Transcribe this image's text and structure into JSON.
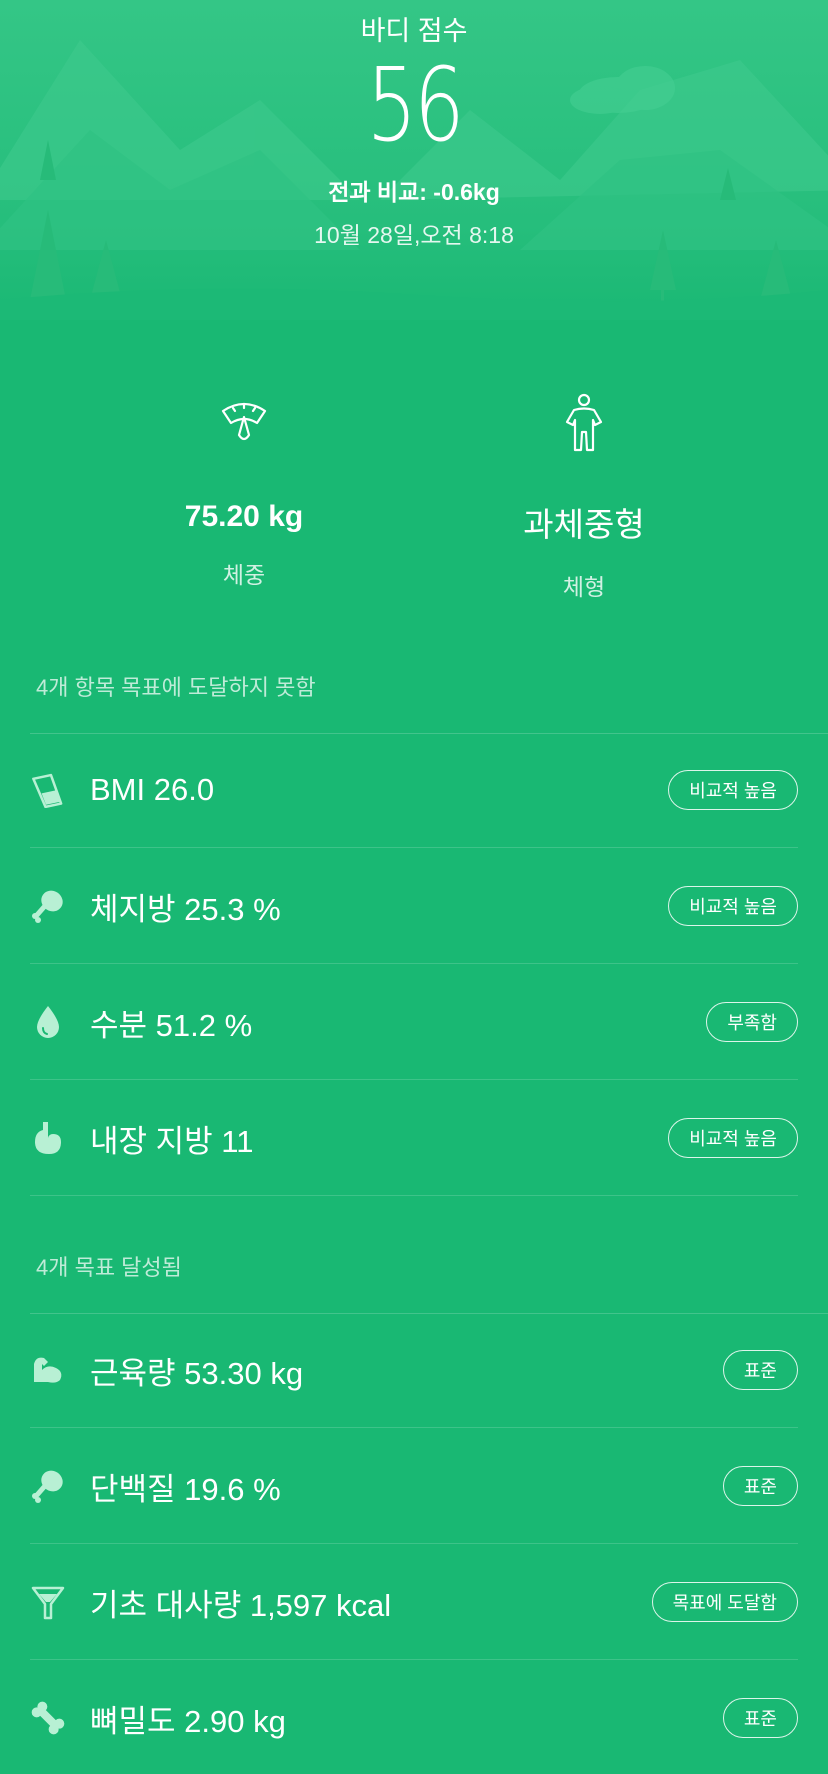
{
  "header": {
    "title": "바디 점수",
    "score": "56",
    "compare": "전과 비교: -0.6kg",
    "datetime": "10월 28일,오전 8:18"
  },
  "summary": {
    "weight": {
      "value": "75.20 kg",
      "label": "체중",
      "icon": "scale-icon"
    },
    "body_type": {
      "value": "과체중형",
      "label": "체형",
      "icon": "person-icon"
    }
  },
  "section_unmet": {
    "title": "4개 항목 목표에 도달하지 못함",
    "items": [
      {
        "label": "BMI 26.0",
        "badge": "비교적 높음",
        "icon": "cup-icon"
      },
      {
        "label": "체지방 25.3 %",
        "badge": "비교적 높음",
        "icon": "drumstick-icon"
      },
      {
        "label": "수분 51.2 %",
        "badge": "부족함",
        "icon": "water-drop-icon"
      },
      {
        "label": "내장 지방 11",
        "badge": "비교적 높음",
        "icon": "stomach-icon"
      }
    ]
  },
  "section_met": {
    "title": "4개 목표 달성됨",
    "items": [
      {
        "label": "근육량 53.30 kg",
        "badge": "표준",
        "icon": "muscle-arm-icon"
      },
      {
        "label": "단백질 19.6 %",
        "badge": "표준",
        "icon": "drumstick-icon"
      },
      {
        "label": "기초 대사량 1,597 kcal",
        "badge": "목표에 도달함",
        "icon": "funnel-icon"
      },
      {
        "label": "뼈밀도 2.90 kg",
        "badge": "표준",
        "icon": "bone-icon"
      }
    ]
  },
  "colors": {
    "background": "#19b873",
    "header_top": "#34c686",
    "icon_tint": "#b8f0d4"
  }
}
